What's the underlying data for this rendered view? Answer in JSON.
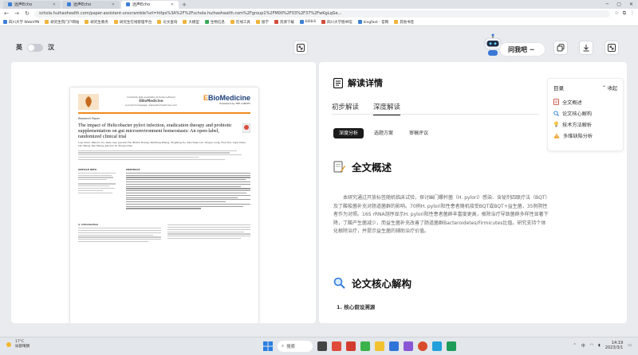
{
  "browser": {
    "tabs": [
      {
        "label": "远声Echo",
        "active": false
      },
      {
        "label": "远声Echo",
        "active": false
      },
      {
        "label": "远声Echo",
        "active": true
      }
    ],
    "new_tab": "+",
    "url": "schola.huihaohealth.com/paper-assistant-unscramble?url=https%3A%2F%2Fschola.huihaohealth.com%2Fgroup1%2FM00%2F03%2F37%2FwKgLqGe..."
  },
  "bookmarks": [
    {
      "label": "四川大学 WebVPN",
      "color": "#3d7fd6"
    },
    {
      "label": "研究生院门户网站",
      "color": "#f0b43c"
    },
    {
      "label": "研究生教务",
      "color": "#f0b43c"
    },
    {
      "label": "研究生在线管理平台",
      "color": "#f0b43c"
    },
    {
      "label": "论文查询",
      "color": "#f0b43c"
    },
    {
      "label": "大模型",
      "color": "#f0b43c"
    },
    {
      "label": "生物信息",
      "color": "#3caa5a"
    },
    {
      "label": "在线工具",
      "color": "#f0b43c"
    },
    {
      "label": "留学",
      "color": "#f0b43c"
    },
    {
      "label": "资源下载",
      "color": "#d34b3b"
    },
    {
      "label": "bilibili",
      "color": "#3d7fd6"
    },
    {
      "label": "四川大学图书馆",
      "color": "#d34b3b"
    },
    {
      "label": "kingfast - 官网",
      "color": "#3d7fd6"
    },
    {
      "label": "其他书签",
      "color": "#f0b43c"
    }
  ],
  "toolbar": {
    "lang_en": "英",
    "lang_zh": "汉",
    "ask_label": "问我吧 ~"
  },
  "paper": {
    "journal_info": "Contents lists available at ScienceDirect",
    "journal_name": "EBioMedicine",
    "journal_name_suffix": "",
    "journal_home": "journal homepage: www.ebiomedicine.com",
    "publisher": "Published by THE LANCET",
    "type": "Research Paper",
    "title": "The impact of Helicobacter pylori infection, eradication therapy and probiotic supplementation on gut microenvironment homeostasis: An open-label, randomized clinical trial",
    "authors": "Luyi Chen, Wenxin Xu, Allen Lee, Jianmin He, Binbin Huang, Wenfang Zheng, Tongfeng Su, Sanchuan Lai, Yanyan Long, Hua Chu, Yujia Chen, Lan Wang, Kan Wang, Jianmin Si, Shujie Chen",
    "article_info": "ARTICLE INFO",
    "abstract": "ABSTRACT",
    "introduction": "1. Introduction"
  },
  "reader": {
    "title": "解读详情",
    "tabs": [
      "初步解读",
      "深度解读"
    ],
    "chips": [
      "深度分析",
      "选题方案",
      "审稿评议"
    ],
    "overview_heading": "全文概述",
    "overview_text": "本研究通过开放标签随机临床试验，探讨幽门螺杆菌（H. pylori）感染、含铋剂四联疗法（BQT）及丁酸梭菌补充对肠道菌群的影响。70例H. pylori阳性患者随机接受BQT或BQT+益生菌，35例阴性者作为对照。16S rRNA测序显示H. pylori阳性患者菌群丰富度更高，根除治疗导致菌群多样性显著下降，丁酸产生菌减少，而益生菌补充改善了肠道菌群Bacteroidetes/Firmicutes比值。研究支持个体化根除治疗，并提示益生菌的辅助治疗价值。",
    "core_heading": "论文核心解构",
    "core_sub": "1. 核心假设溯源"
  },
  "toc": {
    "title": "目录",
    "collapse_label": "收起",
    "items": [
      {
        "label": "全文概述",
        "icon": "document-icon"
      },
      {
        "label": "论文核心解构",
        "icon": "search-icon"
      },
      {
        "label": "技术方法解析",
        "icon": "bulb-icon"
      },
      {
        "label": "多维缺陷分析",
        "icon": "warning-icon"
      }
    ]
  },
  "taskbar": {
    "weather_temp": "17°C",
    "weather_desc": "局部晴朗",
    "search_label": "搜索",
    "time": "14:19",
    "date": "2023/3/1",
    "lang": "中"
  }
}
